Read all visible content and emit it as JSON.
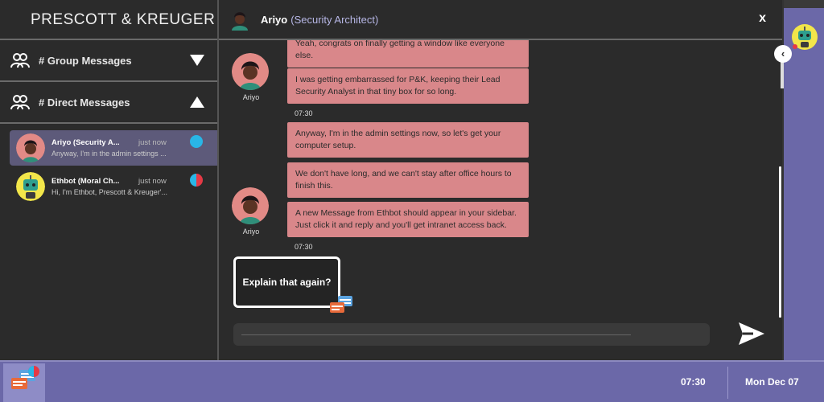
{
  "brand": "PRESCOTT & KREUGER",
  "sidebar": {
    "sections": [
      {
        "label": "# Group Messages",
        "state": "collapsed"
      },
      {
        "label": "# Direct Messages",
        "state": "expanded"
      }
    ],
    "direct_messages": [
      {
        "name": "Ariyo (Security A...",
        "time": "just now",
        "preview": "Anyway, I'm in the admin settings ...",
        "active": true,
        "dot_color": "#29b6e6"
      },
      {
        "name": "Ethbot (Moral Ch...",
        "time": "just now",
        "preview": "Hi, I'm Ethbot, Prescott & Kreuger'...",
        "active": false,
        "dot_color": "#e53945"
      }
    ]
  },
  "chat": {
    "header_name": "Ariyo",
    "header_role": "(Security Architect)",
    "close_label": "x",
    "sender_name": "Ariyo",
    "messages": [
      {
        "text": "Yeah, congrats on finally getting a window like everyone else."
      },
      {
        "text": "I was getting embarrassed for P&K, keeping their Lead Security Analyst in that tiny box for so long."
      },
      {
        "text": "Anyway, I'm in the admin settings now, so let's get your computer setup."
      },
      {
        "text": "We don't have long, and we can't stay after office hours to finish this."
      },
      {
        "text": "A new Message from Ethbot should appear in your sidebar. Just click it and reply and you'll get intranet access back."
      }
    ],
    "timestamps": [
      "07:30",
      "07:30"
    ],
    "reply_option": "Explain that again?"
  },
  "taskbar": {
    "time": "07:30",
    "date": "Mon Dec 07"
  },
  "colors": {
    "bubble": "#d9878a",
    "accent": "#6b68a8",
    "active_item": "#5d5a7a"
  }
}
